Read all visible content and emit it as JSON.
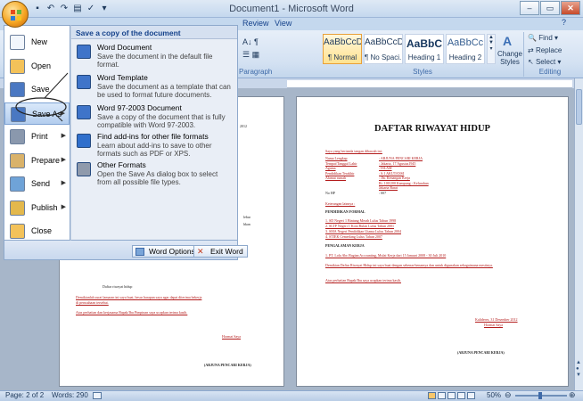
{
  "window": {
    "title": "Document1 - Microsoft Word",
    "controls": [
      "minimize",
      "maximize",
      "close"
    ]
  },
  "ribbon": {
    "tabs": [
      "Review",
      "View"
    ],
    "groups": {
      "paragraph": "Paragraph",
      "styles": "Styles",
      "editing": "Editing"
    },
    "styles": [
      {
        "sample": "AaBbCcDc",
        "name": "¶ Normal",
        "selected": true
      },
      {
        "sample": "AaBbCcDc",
        "name": "¶ No Spaci...",
        "selected": false
      },
      {
        "sample": "AaBbC",
        "name": "Heading 1",
        "selected": false
      },
      {
        "sample": "AaBbCc",
        "name": "Heading 2",
        "selected": false
      }
    ],
    "change_styles": "Change Styles",
    "editing": {
      "find": "Find",
      "replace": "Replace",
      "select": "Select"
    }
  },
  "office_menu": {
    "items": [
      {
        "label": "New",
        "icon": "new-document-icon",
        "has_arrow": false,
        "highlighted": false
      },
      {
        "label": "Open",
        "icon": "folder-open-icon",
        "has_arrow": false,
        "highlighted": false
      },
      {
        "label": "Save",
        "icon": "save-icon",
        "has_arrow": false,
        "highlighted": false
      },
      {
        "label": "Save As",
        "icon": "save-as-icon",
        "has_arrow": true,
        "highlighted": true
      },
      {
        "label": "Print",
        "icon": "printer-icon",
        "has_arrow": true,
        "highlighted": false
      },
      {
        "label": "Prepare",
        "icon": "prepare-icon",
        "has_arrow": true,
        "highlighted": false
      },
      {
        "label": "Send",
        "icon": "send-icon",
        "has_arrow": true,
        "highlighted": false
      },
      {
        "label": "Publish",
        "icon": "publish-icon",
        "has_arrow": true,
        "highlighted": false
      },
      {
        "label": "Close",
        "icon": "close-folder-icon",
        "has_arrow": false,
        "highlighted": false
      }
    ],
    "submenu": {
      "header": "Save a copy of the document",
      "items": [
        {
          "title": "Word Document",
          "desc": "Save the document in the default file format.",
          "icon": "word-document-icon"
        },
        {
          "title": "Word Template",
          "desc": "Save the document as a template that can be used to format future documents.",
          "icon": "word-template-icon"
        },
        {
          "title": "Word 97-2003 Document",
          "desc": "Save a copy of the document that is fully compatible with Word 97-2003.",
          "icon": "word-97-2003-icon"
        },
        {
          "title": "Find add-ins for other file formats",
          "desc": "Learn about add-ins to save to other formats such as PDF or XPS.",
          "icon": "info-icon"
        },
        {
          "title": "Other Formats",
          "desc": "Open the Save As dialog box to select from all possible file types.",
          "icon": "other-formats-icon"
        }
      ]
    },
    "word_options": "Word Options",
    "exit_word": "Exit Word"
  },
  "document_right": {
    "title": "DAFTAR RIWAYAT HIDUP",
    "intro": "Saya yang bertanda tangan dibawah ini:",
    "fields": [
      [
        "Nama Lengkap",
        ": ARJUNA PENCARI KERJA"
      ],
      [
        "Tempat/Tanggal Lahir",
        ": Jakarta, 17 Agustus1945"
      ],
      [
        "Agama",
        ": ISLAM"
      ],
      [
        "Pendidikan Terakhir",
        ": S.1 AKUTANSI"
      ],
      [
        "Alamat rumah",
        ": Jln. Kenangan Kerja"
      ],
      [
        "",
        "Rt. 100/200 Kampung - Kelurahan"
      ],
      [
        "",
        "Jakarta Barat"
      ],
      [
        "No HP",
        ": 007"
      ]
    ],
    "keterangan": "Keterangan lainnya :",
    "h_formal": "PENDIDIKAN FORMAL",
    "formal": [
      "1.  SD Negeri 1 Bintang Merah           Lulus Tahun 1998",
      "2.  SLTP Negeri 1 Kota Bulan            Lulus Tahun 2001",
      "3.  SMA Negeri Pendidikan Utama         Lulus Tahun 2004",
      "4.  STIEK Cemerlang                     Lulus Tahun 2007"
    ],
    "h_kerja": "PENGALAMAN KERJA",
    "kerja": "1.  PT. Lola Abc Bagian Accounting, Mulai Kerja dari 15 Januari 2008 - 30 Juli 2010",
    "closing1": "Demikian Daftar Riwayat Hidup ini saya buat dengan sebenar-benarnya dan untuk digunakan sebagaimana mestinya.",
    "closing2": "Atas perhatian Bapak/Ibu saya ucapkan terima kasih.",
    "sign_place": "Kalideres, 31 Desember 2012",
    "sign_label": "Hormat Saya",
    "sign_name": "(ARJUNA PENCARI KERJA)"
  },
  "document_left": {
    "lines": [
      "Daftar riwayat hidup",
      "Demikianlah surat lamaran ini saya buat, besar harapan saya agar dapat diterima bekerja",
      "di perusahaan tersebut.",
      "Atas perhatian dan kerjasama Bapak/Ibu Pimpinan saya ucapkan terima kasih."
    ],
    "sign_label": "Hormat Saya",
    "sign_name": "(ARJUNA PENCARI KERJA)",
    "fragment_date": "2012",
    "fragment_1": "lebar",
    "fragment_2": "hkan"
  },
  "status": {
    "page": "Page: 2 of 2",
    "words": "Words: 290",
    "zoom": "50%"
  },
  "colors": {
    "accent": "#15428b",
    "ribbon": "#d3e1f2",
    "highlight": "#b3cdee",
    "doc_bg": "#a7b6c9"
  }
}
